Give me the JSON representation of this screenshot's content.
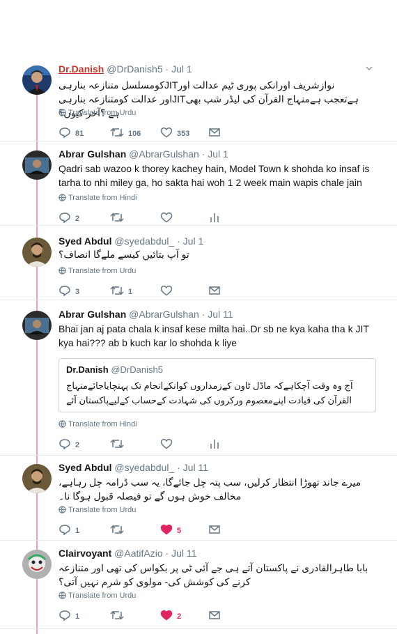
{
  "tweets": [
    {
      "name": "Dr.Danish",
      "handle": "@DrDanish5",
      "dot": "·",
      "date": "Jul 1",
      "text": "نوازشریف اورانکی پوری ٹیم عدالت اورJITکومسلسل متنازعہ بنارہی ہےتعجب ہےمنہاج القرآن کی لیڈر شپ بھیJITاور عدالت کومتنازعہ بنارہی ہے ؟آخر کیوں؟",
      "translate": "Translate from Urdu",
      "reply": "81",
      "retweet": "106",
      "like": "353",
      "avatar_color": "#1e3a6b"
    },
    {
      "name": "Abrar Gulshan",
      "handle": "@AbrarGulshan",
      "dot": "·",
      "date": "Jul 1",
      "text": "Qadri sab wazoo k thorey kachey hain, Model Town k shohda ko insaf is tarha to nhi miley ga, ho sakta hai woh 1 2 week main wapis chale jain",
      "translate": "Translate from Hindi",
      "reply": "2",
      "avatar_color": "#2b2b2b"
    },
    {
      "name": "Syed Abdul",
      "handle": "@syedabdul_",
      "dot": "·",
      "date": "Jul 1",
      "text": "تو آپ بتائیں کیسے ملےگا انصاف؟",
      "translate": "Translate from Urdu",
      "reply": "3",
      "retweet": "1",
      "avatar_color": "#6b5a3a"
    },
    {
      "name": "Abrar Gulshan",
      "handle": "@AbrarGulshan",
      "dot": "·",
      "date": "Jul 11",
      "text": "Bhai jan aj pata chala k insaf kese milta hai..Dr sb ne kya kaha tha k JIT kya hai??? ab b kuch kar lo shohda k liye",
      "quote_name": "Dr.Danish",
      "quote_handle": "@DrDanish5",
      "quote_text": "آج وہ وقت آچکاہےکہ ماڈل ٹاون کےزمداروں کوانکےانجام تک پہنچایاجائےمنہاج القرآن کی قیادت اپنےمعصوم ورکروں کی شہادت کےحساب کےلیےپاکستان آئے",
      "translate": "Translate from Hindi",
      "reply": "2",
      "avatar_color": "#2b2b2b"
    },
    {
      "name": "Syed Abdul",
      "handle": "@syedabdul_",
      "dot": "·",
      "date": "Jul 11",
      "text": "میرے جاند تھوڑا انتظار کرلیں، سب پتہ چل جائےگا، یہ سب ڈرامہ چل رہاہے، مخالف خوش ہوں گے تو فیصلہ قبول ہوگا نا۔",
      "translate": "Translate from Urdu",
      "reply": "1",
      "like": "5",
      "avatar_color": "#6b5a3a"
    },
    {
      "name": "Clairvoyant",
      "handle": "@AatifAzio",
      "dot": "·",
      "date": "Jul 11",
      "text": "بابا طاہرالقادری نے پاکستان آتے ہی جے آئی ٹی پر بکواس کی تھی اور متنازعہ کرنے کی کوشش کی- مولوی کو شرم نہیں آتی؟",
      "translate": "Translate from Urdu",
      "reply": "1",
      "like": "2",
      "avatar_color": "#8a8a8a"
    }
  ],
  "colors": {
    "thread_line": "#e8a3ad",
    "like_active": "#e0245e",
    "muted": "#657786"
  }
}
